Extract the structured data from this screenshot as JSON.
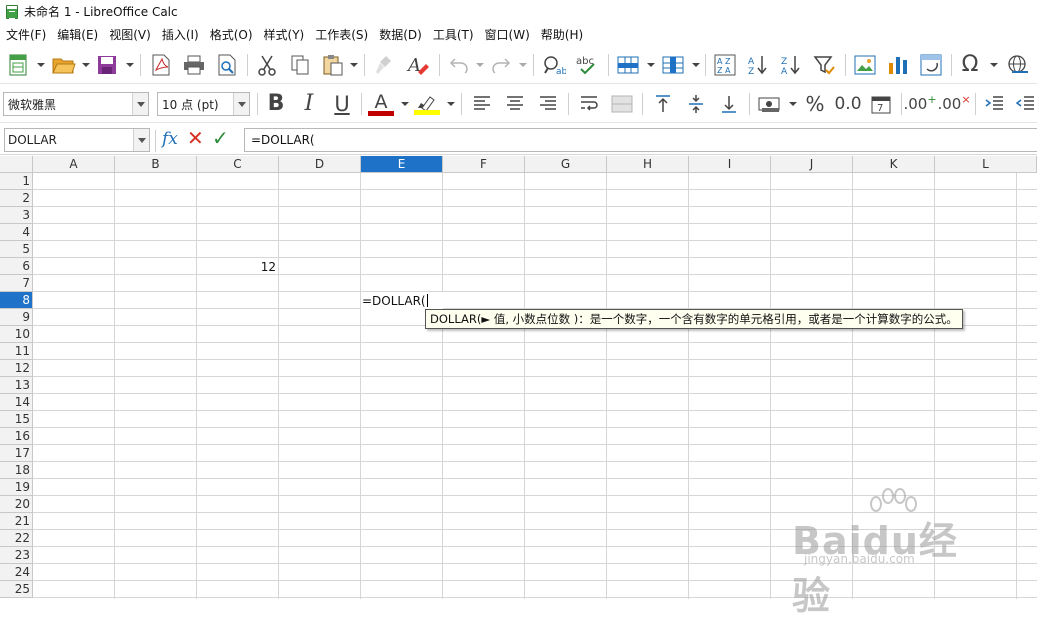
{
  "window": {
    "title": "未命名 1 - LibreOffice Calc"
  },
  "menu": [
    "文件(F)",
    "编辑(E)",
    "视图(V)",
    "插入(I)",
    "格式(O)",
    "样式(Y)",
    "工作表(S)",
    "数据(D)",
    "工具(T)",
    "窗口(W)",
    "帮助(H)"
  ],
  "format_bar": {
    "font_name": "微软雅黑",
    "font_size": "10 点 (pt)",
    "bold": "B",
    "italic": "I",
    "underline": "U",
    "font_color_glyph": "A",
    "percent": "%",
    "decimal": "0.0",
    "add_decimal": ".00",
    "del_decimal": ".00"
  },
  "formula_bar": {
    "name_box": "DOLLAR",
    "fx_label": "fx",
    "formula": "=DOLLAR("
  },
  "columns": [
    "A",
    "B",
    "C",
    "D",
    "E",
    "F",
    "G",
    "H",
    "I",
    "J",
    "K",
    "L"
  ],
  "rows": [
    "1",
    "2",
    "3",
    "4",
    "5",
    "6",
    "7",
    "8",
    "9",
    "10",
    "11",
    "12",
    "13",
    "14",
    "15",
    "16",
    "17",
    "18",
    "19",
    "20",
    "21",
    "22",
    "23",
    "24",
    "25"
  ],
  "selected": {
    "column": "E",
    "row": "8"
  },
  "cells": {
    "C6": "12",
    "E8": "=DOLLAR("
  },
  "tooltip": "DOLLAR(► 值, 小数点位数 )：是一个数字，一个含有数字的单元格引用，或者是一个计算数字的公式。",
  "watermark": {
    "text": "Baidu经验",
    "sub": "jingyan.baidu.com"
  },
  "colors": {
    "selection": "#1e73c8",
    "font_color": "#c00000",
    "highlight": "#ffff00"
  }
}
